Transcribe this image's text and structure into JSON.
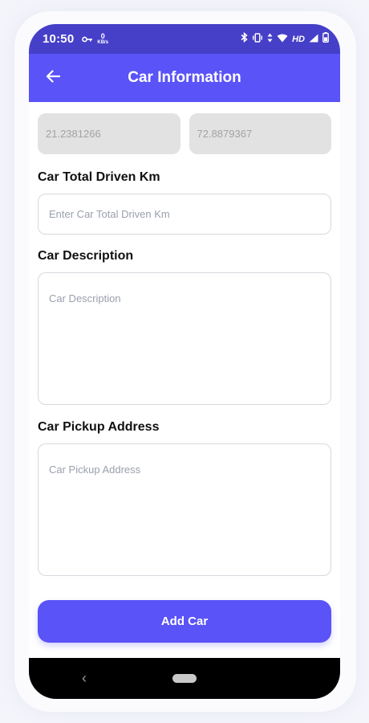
{
  "status_bar": {
    "time": "10:50",
    "speed_value": "0",
    "speed_unit": "KB/s",
    "network_badge": "HD"
  },
  "app_bar": {
    "title": "Car Information",
    "back_icon": "arrow-left-icon"
  },
  "coordinates": {
    "latitude": "21.2381266",
    "longitude": "72.8879367"
  },
  "form": {
    "km_label": "Car Total Driven Km",
    "km_placeholder": "Enter Car Total Driven Km",
    "description_label": "Car Description",
    "description_placeholder": "Car Description",
    "address_label": "Car Pickup Address",
    "address_placeholder": "Car Pickup Address"
  },
  "actions": {
    "add_car_label": "Add Car"
  },
  "nav_bar": {
    "back_glyph": "‹"
  },
  "colors": {
    "status_bar": "#463fc8",
    "app_bar": "#5a53f7",
    "button": "#5a53f7",
    "disabled_field": "#e2e2e2"
  }
}
